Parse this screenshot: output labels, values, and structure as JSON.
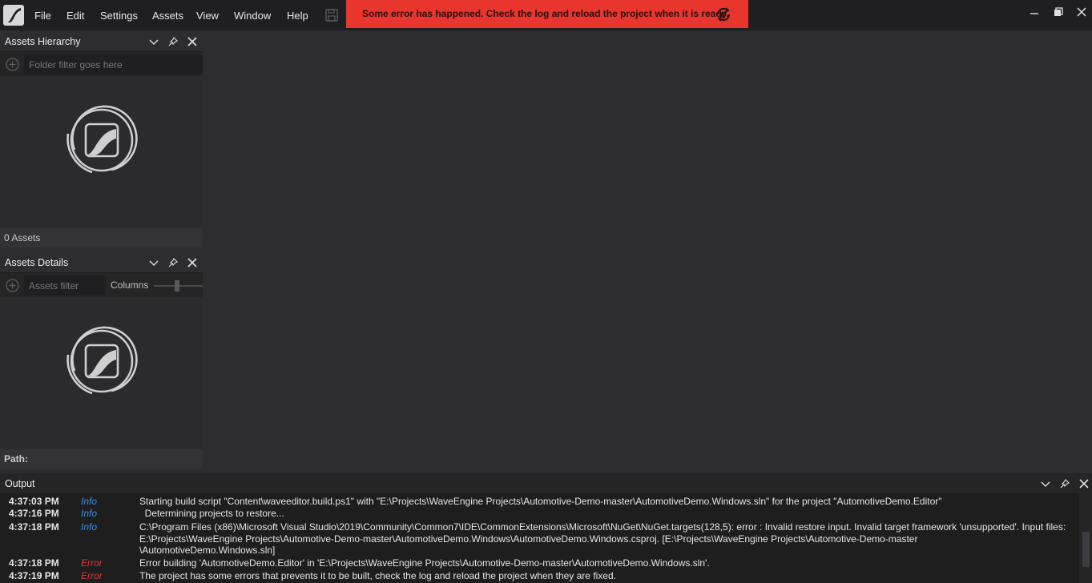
{
  "menu": {
    "items": [
      "File",
      "Edit",
      "Settings",
      "Assets",
      "View",
      "Window",
      "Help"
    ]
  },
  "error_banner": {
    "message": "Some error has happened. Check the log and reload the project when it is ready.",
    "color": "#e8362e"
  },
  "assets_hierarchy": {
    "title": "Assets Hierarchy",
    "filter_placeholder": "Folder filter goes here",
    "footer": "0 Assets"
  },
  "assets_details": {
    "title": "Assets Details",
    "filter_placeholder": "Assets filter",
    "columns_label": "Columns",
    "footer": "Path:"
  },
  "output": {
    "title": "Output",
    "rows": [
      {
        "time": "4:37:03 PM",
        "level": "Info",
        "message": "Starting build script \"Content\\waveeditor.build.ps1\" with \"E:\\Projects\\WaveEngine Projects\\Automotive-Demo-master\\AutomotiveDemo.Windows.sln\" for the project \"AutomotiveDemo.Editor\""
      },
      {
        "time": "4:37:16 PM",
        "level": "Info",
        "message": "  Determining projects to restore..."
      },
      {
        "time": "4:37:18 PM",
        "level": "Info",
        "message": "C:\\Program Files (x86)\\Microsoft Visual Studio\\2019\\Community\\Common7\\IDE\\CommonExtensions\\Microsoft\\NuGet\\NuGet.targets(128,5): error : Invalid restore input. Invalid target framework 'unsupported'. Input files: E:\\Projects\\WaveEngine Projects\\Automotive-Demo-master\\AutomotiveDemo.Windows\\AutomotiveDemo.Windows.csproj. [E:\\Projects\\WaveEngine Projects\\Automotive-Demo-master\n\\AutomotiveDemo.Windows.sln]"
      },
      {
        "time": "4:37:18 PM",
        "level": "Error",
        "message": "Error building 'AutomotiveDemo.Editor' in 'E:\\Projects\\WaveEngine Projects\\Automotive-Demo-master\\AutomotiveDemo.Windows.sln'."
      },
      {
        "time": "4:37:19 PM",
        "level": "Error",
        "message": "The project has some errors that prevents it to be built, check the log and reload the project when they are fixed."
      }
    ]
  },
  "colors": {
    "info": "#3a8ee6",
    "error": "#e03a34"
  }
}
